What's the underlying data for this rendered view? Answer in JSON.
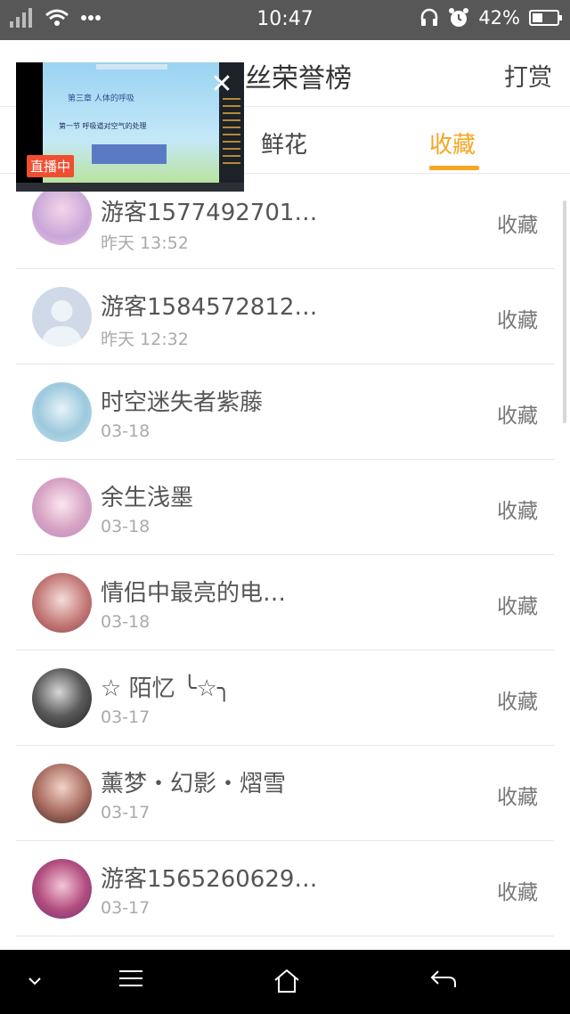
{
  "status_bar": {
    "time": "10:47",
    "battery_text": "42%",
    "battery_level": 0.42
  },
  "header": {
    "title": "粉丝荣誉榜",
    "reward_label": "打赏"
  },
  "tabs": [
    {
      "label": ""
    },
    {
      "label": "鲜花"
    },
    {
      "label": "收藏"
    }
  ],
  "active_tab": 2,
  "accent_color": "#f5a623",
  "live_overlay": {
    "badge": "直播中",
    "slide_title": "第三章 人体的呼吸",
    "slide_subtitle": "第一节 呼吸道对空气的处理"
  },
  "list": [
    {
      "name": "游客1577492701…",
      "time": "昨天 13:52",
      "action": "收藏"
    },
    {
      "name": "游客1584572812…",
      "time": "昨天 12:32",
      "action": "收藏"
    },
    {
      "name": "时空迷失者紫藤",
      "time": "03-18",
      "action": "收藏"
    },
    {
      "name": "余生浅墨",
      "time": "03-18",
      "action": "收藏"
    },
    {
      "name": "情侣中最亮的电…",
      "time": "03-18",
      "action": "收藏"
    },
    {
      "name": "☆ 陌忆 ╰☆╮",
      "time": "03-17",
      "action": "收藏"
    },
    {
      "name": "薰梦・幻影・熠雪",
      "time": "03-17",
      "action": "收藏"
    },
    {
      "name": "游客1565260629…",
      "time": "03-17",
      "action": "收藏"
    }
  ]
}
